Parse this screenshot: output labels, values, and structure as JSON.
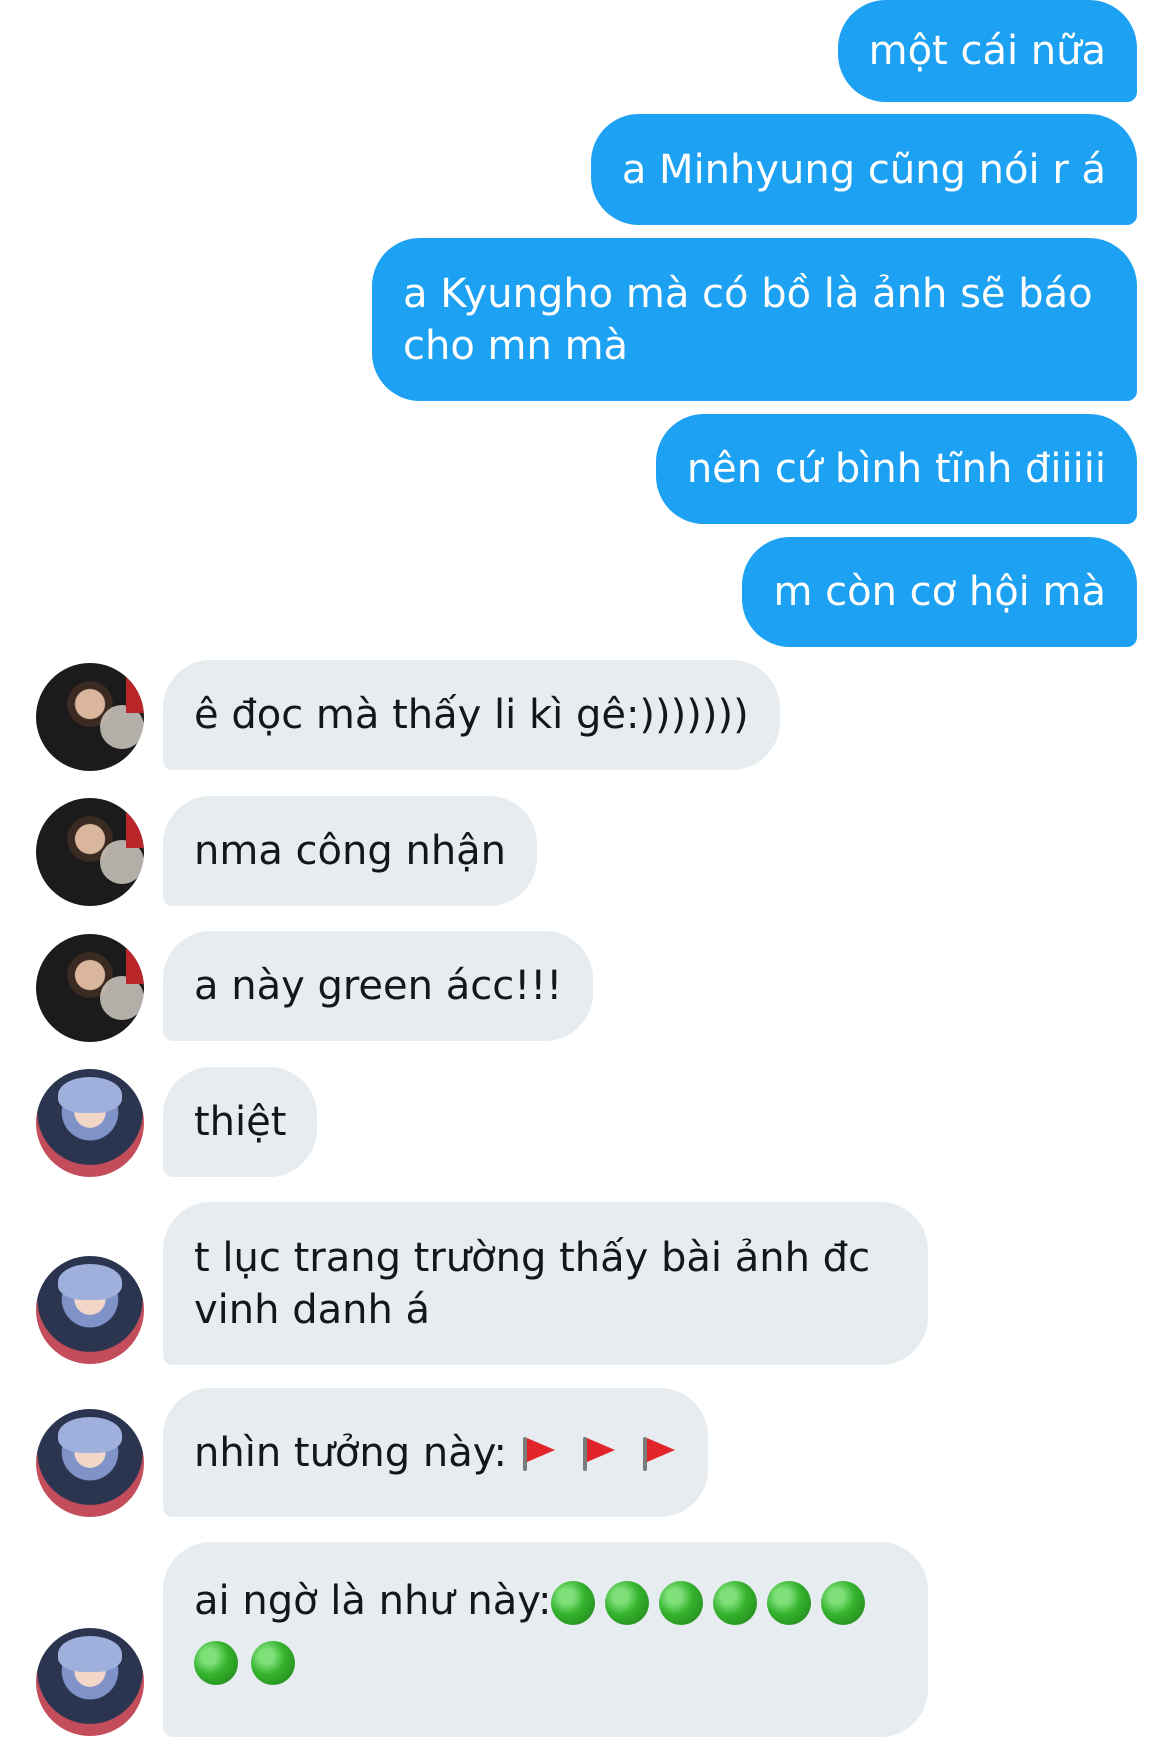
{
  "messages": [
    {
      "dir": "out",
      "text": "một cái nữa"
    },
    {
      "dir": "out",
      "text": "a Minhyung cũng nói r á"
    },
    {
      "dir": "out",
      "text": "a Kyungho mà có bồ là ảnh sẽ báo cho mn mà"
    },
    {
      "dir": "out",
      "text": "nên cứ bình tĩnh điiiii"
    },
    {
      "dir": "out",
      "text": "m còn cơ hội mà"
    },
    {
      "dir": "in",
      "avatar": "avatar-user-dark",
      "text": "ê đọc mà thấy li kì gê:)))))))"
    },
    {
      "dir": "in",
      "avatar": "avatar-user-dark",
      "text": "nma công nhận"
    },
    {
      "dir": "in",
      "avatar": "avatar-user-dark",
      "text": "a này green ácc!!!"
    },
    {
      "dir": "in",
      "avatar": "avatar-user-blue-hair",
      "text": "thiệt"
    },
    {
      "dir": "in",
      "avatar": "avatar-user-blue-hair",
      "text": "t lục trang trường thấy bài ảnh đc vinh danh á"
    },
    {
      "dir": "in",
      "avatar": "avatar-user-blue-hair",
      "text": "nhìn tưởng này:",
      "emoji": [
        "red-flag",
        "red-flag",
        "red-flag"
      ]
    },
    {
      "dir": "in",
      "avatar": "avatar-user-blue-hair",
      "text": "ai ngờ là như này:",
      "emoji": [
        "green-circle",
        "green-circle",
        "green-circle",
        "green-circle",
        "green-circle",
        "green-circle",
        "green-circle",
        "green-circle"
      ]
    }
  ],
  "colors": {
    "outgoing_bubble": "#1da1f2",
    "incoming_bubble": "#e6ecf0",
    "outgoing_text": "#ffffff",
    "incoming_text": "#14171a"
  }
}
